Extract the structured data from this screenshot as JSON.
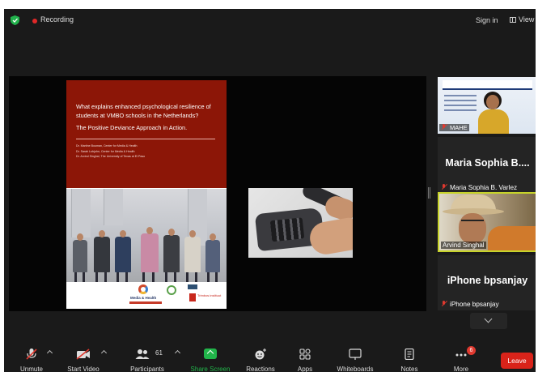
{
  "topbar": {
    "recording_label": "Recording",
    "signin_label": "Sign in",
    "view_label": "View"
  },
  "slide": {
    "title": "What explains enhanced psychological resilience of students at VMBO schools in the Netherlands?",
    "subtitle": "The Positive Deviance Approach in Action.",
    "authors": [
      "Dr. Martine Bouman, Center for Media & Health",
      "Dr. Sarah Lubjuhn, Center for Media & Health",
      "Dr. Arvind Singhal, The University of Texas at El Paso"
    ],
    "logo_media_health": "Media & Health",
    "logo_trimbos": "Trimbos instituut"
  },
  "participants": {
    "mahe_label": "MAHE",
    "maria_big": "Maria Sophia B....",
    "maria_name": "Maria Sophia B. Varlez",
    "arvind_name": "Arvind Singhal",
    "iphone_big": "iPhone bpsanjay",
    "iphone_name": "iPhone bpsanjay"
  },
  "toolbar": {
    "unmute": "Unmute",
    "start_video": "Start Video",
    "participants": "Participants",
    "participants_count": "61",
    "share_screen": "Share Screen",
    "reactions": "Reactions",
    "apps": "Apps",
    "whiteboards": "Whiteboards",
    "notes": "Notes",
    "more": "More",
    "more_badge": "6",
    "leave": "Leave"
  },
  "colors": {
    "recording": "#e02828",
    "share_green": "#21b54a",
    "leave_red": "#d9231a",
    "active_speaker": "#c7d32a",
    "slide_red": "#8c1607"
  }
}
